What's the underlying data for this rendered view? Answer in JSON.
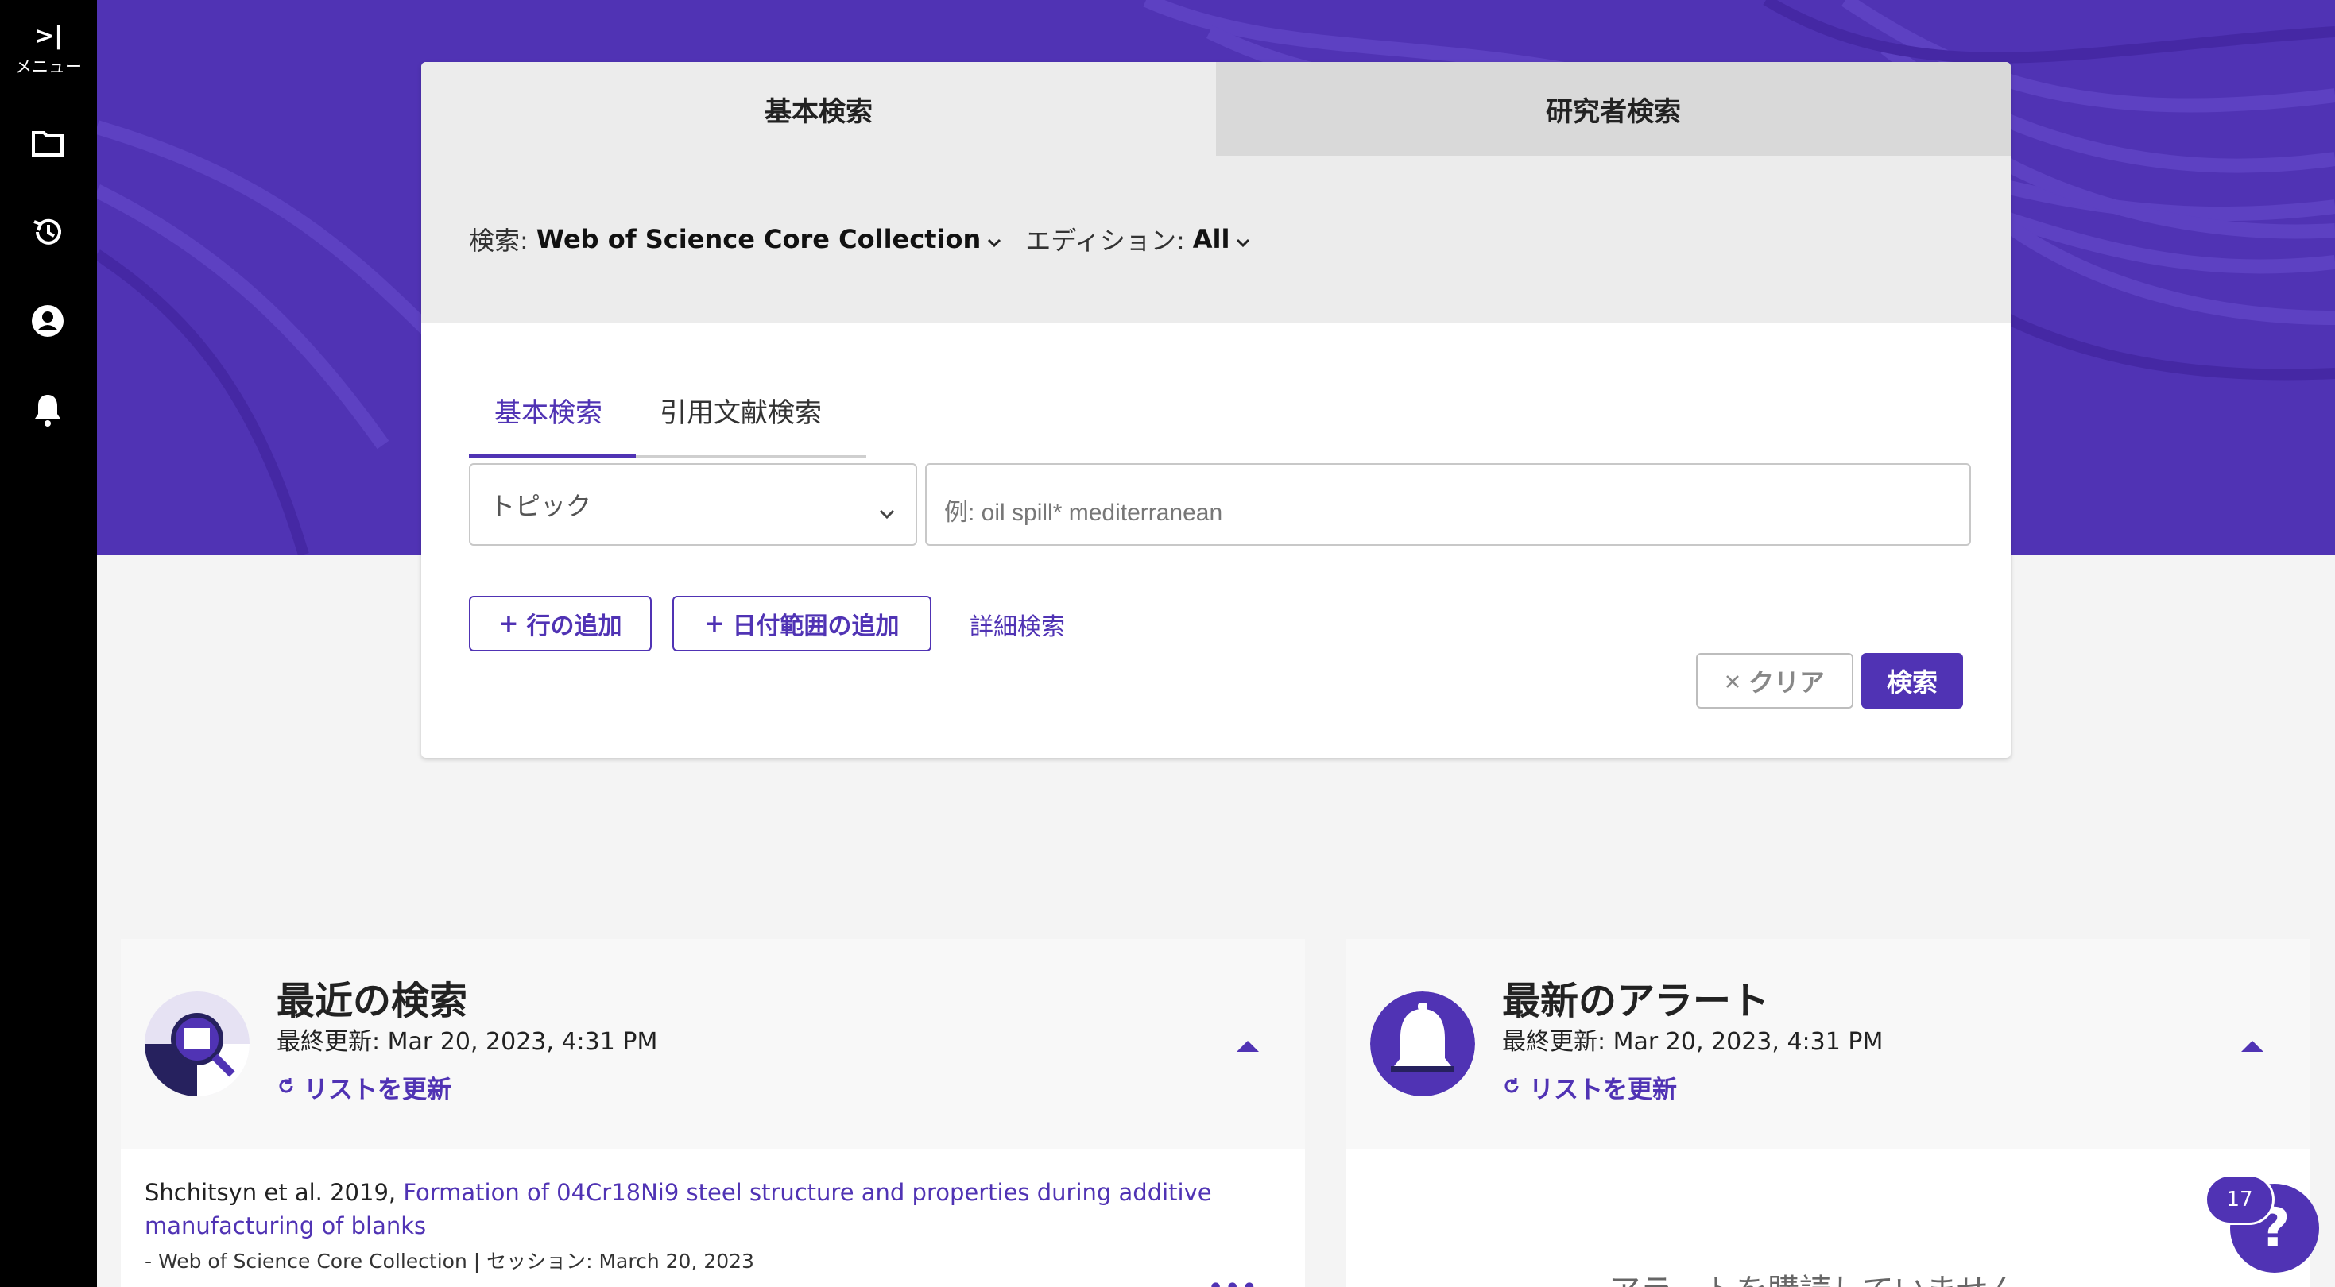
{
  "rail": {
    "menu_chevron": ">|",
    "menu_label": "メニュー",
    "icons": [
      "folder-icon",
      "history-icon",
      "account-icon",
      "bell-icon"
    ]
  },
  "search": {
    "tabs": {
      "basic": "基本検索",
      "researcher": "研究者検索"
    },
    "collection_key": "検索:",
    "collection_value": "Web of Science Core Collection",
    "edition_key": "エディション:",
    "edition_value": "All",
    "subtabs": {
      "basic": "基本検索",
      "cited": "引用文献検索"
    },
    "field_select": "トピック",
    "query_placeholder": "例: oil spill* mediterranean",
    "add_row": "行の追加",
    "add_date_range": "日付範囲の追加",
    "advanced": "詳細検索",
    "clear": "クリア",
    "submit": "検索"
  },
  "recent": {
    "title": "最近の検索",
    "updated": "最終更新: Mar 20, 2023, 4:31 PM",
    "refresh": "リストを更新",
    "item": {
      "authors": "Shchitsyn et al. 2019,",
      "title": "Formation of 04Cr18Ni9 steel structure and properties during additive manufacturing of blanks",
      "meta": "- Web of Science Core Collection | セッション: March 20, 2023"
    },
    "more": "•••"
  },
  "alerts": {
    "title": "最新のアラート",
    "updated": "最終更新: Mar 20, 2023, 4:31 PM",
    "refresh": "リストを更新",
    "empty": "アラートを購読していません"
  },
  "help": {
    "badge": "17",
    "label": "?"
  },
  "colors": {
    "accent": "#5033b4",
    "rail": "#000000",
    "page": "#f4f4f4"
  }
}
